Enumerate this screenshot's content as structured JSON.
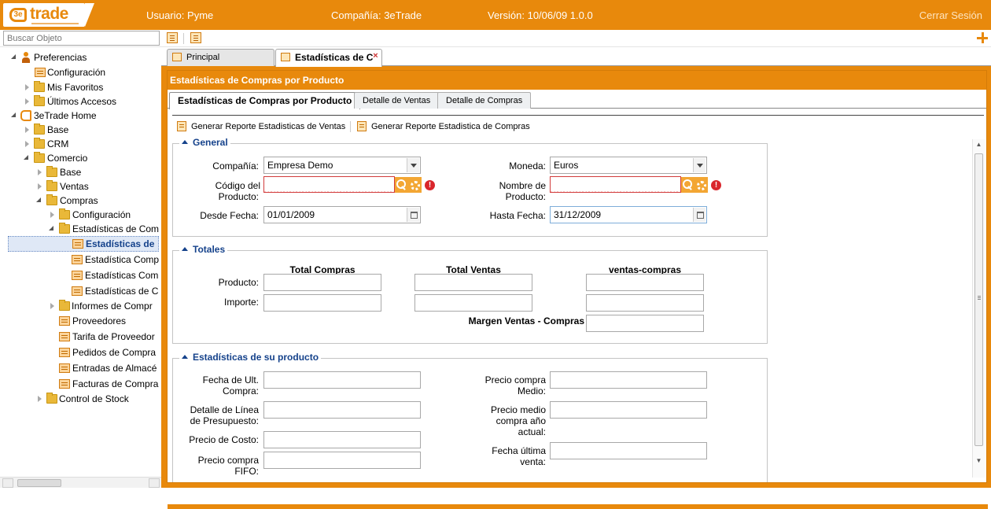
{
  "topbar": {
    "logo_mark": "3e",
    "logo_word": "trade",
    "usuario": "Usuario: Pyme",
    "compania": "Compañía: 3eTrade",
    "version": "Versión: 10/06/09 1.0.0",
    "logout": "Cerrar Sesión"
  },
  "search": {
    "placeholder": "Buscar Objeto"
  },
  "icons": {
    "toolbar": [
      "collapse-tree-icon",
      "expand-tree-icon",
      "add-icon"
    ]
  },
  "tree": {
    "items": [
      {
        "label": "Preferencias",
        "icon": "person-icon"
      },
      {
        "label": "Configuración",
        "icon": "form-icon"
      },
      {
        "label": "Mis Favoritos",
        "icon": "folder-icon"
      },
      {
        "label": "Últimos Accesos",
        "icon": "folder-icon"
      },
      {
        "label": "3eTrade Home",
        "icon": "home-icon"
      },
      {
        "label": "Base",
        "icon": "folder-icon"
      },
      {
        "label": "CRM",
        "icon": "folder-icon"
      },
      {
        "label": "Comercio",
        "icon": "folder-icon"
      },
      {
        "label": "Base",
        "icon": "folder-icon"
      },
      {
        "label": "Ventas",
        "icon": "folder-icon"
      },
      {
        "label": "Compras",
        "icon": "folder-icon"
      },
      {
        "label": "Configuración",
        "icon": "folder-icon"
      },
      {
        "label": "Estadísticas de Com",
        "icon": "folder-icon"
      },
      {
        "label": "Estadísticas de",
        "icon": "form-icon"
      },
      {
        "label": "Estadística Comp",
        "icon": "form-icon"
      },
      {
        "label": "Estadísticas Com",
        "icon": "form-icon"
      },
      {
        "label": "Estadísticas de C",
        "icon": "form-icon"
      },
      {
        "label": "Informes de Compr",
        "icon": "folder-icon"
      },
      {
        "label": "Proveedores",
        "icon": "form-icon"
      },
      {
        "label": "Tarifa de Proveedor",
        "icon": "form-icon"
      },
      {
        "label": "Pedidos de Compra",
        "icon": "form-icon"
      },
      {
        "label": "Entradas de Almacé",
        "icon": "form-icon"
      },
      {
        "label": "Facturas de Compra",
        "icon": "form-icon"
      },
      {
        "label": "Control de Stock",
        "icon": "folder-icon"
      }
    ]
  },
  "tabs": [
    {
      "label": "Principal"
    },
    {
      "label": "Estadísticas de C"
    }
  ],
  "panel": {
    "title": "Estadísticas de Compras por Producto",
    "subtabs": [
      "Estadísticas de Compras por Producto",
      "Detalle de Ventas",
      "Detalle de Compras"
    ],
    "actions": [
      "Generar Reporte Estadisticas de Ventas",
      "Generar Reporte Estadistica de Compras"
    ]
  },
  "general": {
    "legend": "General",
    "compania_label": "Compañía:",
    "compania_value": "Empresa Demo",
    "moneda_label": "Moneda:",
    "moneda_value": "Euros",
    "codigo_label_1": "Código del",
    "codigo_label_2": "Producto:",
    "nombre_label_1": "Nombre de",
    "nombre_label_2": "Producto:",
    "desde_label": "Desde Fecha:",
    "desde_value": "01/01/2009",
    "hasta_label": "Hasta Fecha:",
    "hasta_value": "31/12/2009"
  },
  "totales": {
    "legend": "Totales",
    "col_compras": "Total Compras",
    "col_ventas": "Total Ventas",
    "col_diff": "ventas-compras",
    "row_producto": "Producto:",
    "row_importe": "Importe:",
    "margen": "Margen Ventas - Compras"
  },
  "estadisticas": {
    "legend": "Estadísticas de su producto",
    "fecha_ult_1": "Fecha de Ult.",
    "fecha_ult_2": "Compra:",
    "detalle_1": "Detalle de Línea",
    "detalle_2": "de Presupuesto:",
    "precio_costo": "Precio de Costo:",
    "precio_fifo_1": "Precio compra",
    "precio_fifo_2": "FIFO:",
    "precio_medio_1": "Precio compra",
    "precio_medio_2": "Medio:",
    "precio_anio_1": "Precio medio",
    "precio_anio_2": "compra año",
    "precio_anio_3": "actual:",
    "fecha_venta_1": "Fecha última",
    "fecha_venta_2": "venta:"
  },
  "colors": {
    "accent": "#e8890c",
    "link": "#15428b",
    "error": "#d23c3c"
  }
}
